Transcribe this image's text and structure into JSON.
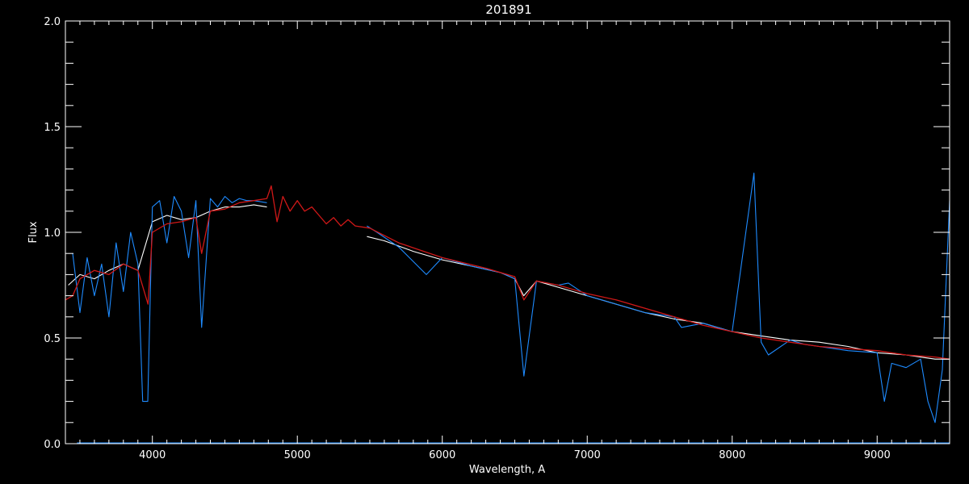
{
  "chart_data": {
    "type": "line",
    "title": "201891",
    "xlabel": "Wavelength, A",
    "ylabel": "Flux",
    "xlim": [
      3400,
      9500
    ],
    "ylim": [
      0.0,
      2.0
    ],
    "x_ticks": [
      4000,
      5000,
      6000,
      7000,
      8000,
      9000
    ],
    "y_ticks": [
      0.0,
      0.5,
      1.0,
      1.5,
      2.0
    ],
    "x_tick_labels": [
      "4000",
      "5000",
      "6000",
      "7000",
      "8000",
      "9000"
    ],
    "y_tick_labels": [
      "0.0",
      "0.5",
      "1.0",
      "1.5",
      "2.0"
    ],
    "grid": false,
    "colors": {
      "background": "#000000",
      "axes": "#ffffff",
      "observed_spectrum": "#ffffff",
      "blue_spectrum": "#1e8bff",
      "model": "#d01818"
    },
    "series": [
      {
        "key": "observed",
        "color": "#ffffff",
        "x": [
          3420,
          3500,
          3600,
          3700,
          3800,
          3900,
          4000,
          4100,
          4200,
          4300,
          4400,
          4500,
          4600,
          4700,
          4790,
          5480,
          5600,
          5800,
          6000,
          6200,
          6400,
          6500,
          6562,
          6650,
          6800,
          7000,
          7200,
          7400,
          7600,
          7800,
          8000,
          8200,
          8400,
          8600,
          8800,
          9000,
          9200,
          9400,
          9500
        ],
        "y": [
          0.75,
          0.8,
          0.78,
          0.82,
          0.85,
          0.82,
          1.05,
          1.08,
          1.06,
          1.07,
          1.1,
          1.12,
          1.12,
          1.13,
          1.12,
          0.98,
          0.96,
          0.91,
          0.87,
          0.84,
          0.81,
          0.78,
          0.7,
          0.77,
          0.74,
          0.7,
          0.66,
          0.62,
          0.59,
          0.57,
          0.53,
          0.51,
          0.49,
          0.48,
          0.46,
          0.43,
          0.42,
          0.4,
          0.4
        ]
      },
      {
        "key": "blue",
        "color": "#1e8bff",
        "x": [
          3450,
          3500,
          3550,
          3600,
          3650,
          3700,
          3750,
          3800,
          3850,
          3900,
          3933,
          3968,
          4000,
          4050,
          4100,
          4150,
          4200,
          4250,
          4300,
          4340,
          4400,
          4450,
          4500,
          4550,
          4600,
          4650,
          4700,
          4790,
          5480,
          5550,
          5700,
          5890,
          6000,
          6200,
          6400,
          6500,
          6563,
          6650,
          6800,
          6870,
          7000,
          7200,
          7400,
          7600,
          7650,
          7800,
          8000,
          8150,
          8200,
          8250,
          8400,
          8500,
          8600,
          8800,
          9000,
          9050,
          9100,
          9200,
          9300,
          9350,
          9400,
          9450,
          9500
        ],
        "y": [
          0.9,
          0.62,
          0.88,
          0.7,
          0.85,
          0.6,
          0.95,
          0.72,
          1.0,
          0.85,
          0.2,
          0.2,
          1.12,
          1.15,
          0.95,
          1.17,
          1.1,
          0.88,
          1.15,
          0.55,
          1.16,
          1.12,
          1.17,
          1.14,
          1.16,
          1.15,
          1.15,
          1.14,
          1.03,
          1.0,
          0.93,
          0.8,
          0.88,
          0.84,
          0.81,
          0.78,
          0.32,
          0.77,
          0.75,
          0.76,
          0.7,
          0.66,
          0.62,
          0.6,
          0.55,
          0.57,
          0.53,
          1.28,
          0.48,
          0.42,
          0.49,
          0.47,
          0.46,
          0.44,
          0.43,
          0.2,
          0.38,
          0.36,
          0.4,
          0.2,
          0.1,
          0.35,
          1.15
        ]
      },
      {
        "key": "model",
        "color": "#d01818",
        "x": [
          3400,
          3450,
          3500,
          3600,
          3700,
          3800,
          3900,
          3970,
          4000,
          4100,
          4200,
          4300,
          4340,
          4400,
          4500,
          4600,
          4700,
          4790,
          4820,
          4860,
          4900,
          4950,
          5000,
          5050,
          5100,
          5150,
          5200,
          5250,
          5300,
          5350,
          5400,
          5500,
          5700,
          6000,
          6300,
          6500,
          6563,
          6650,
          6800,
          7000,
          7200,
          7400,
          7600,
          7800,
          8000,
          8200,
          8400,
          8600,
          8800,
          9000,
          9200,
          9400,
          9500
        ],
        "y": [
          0.68,
          0.7,
          0.78,
          0.82,
          0.8,
          0.85,
          0.82,
          0.66,
          1.0,
          1.04,
          1.05,
          1.07,
          0.9,
          1.1,
          1.11,
          1.14,
          1.15,
          1.16,
          1.22,
          1.05,
          1.17,
          1.1,
          1.15,
          1.1,
          1.12,
          1.08,
          1.04,
          1.07,
          1.03,
          1.06,
          1.03,
          1.02,
          0.95,
          0.88,
          0.83,
          0.79,
          0.68,
          0.77,
          0.75,
          0.71,
          0.68,
          0.64,
          0.6,
          0.56,
          0.53,
          0.5,
          0.48,
          0.46,
          0.45,
          0.44,
          0.42,
          0.41,
          0.4
        ]
      }
    ]
  }
}
